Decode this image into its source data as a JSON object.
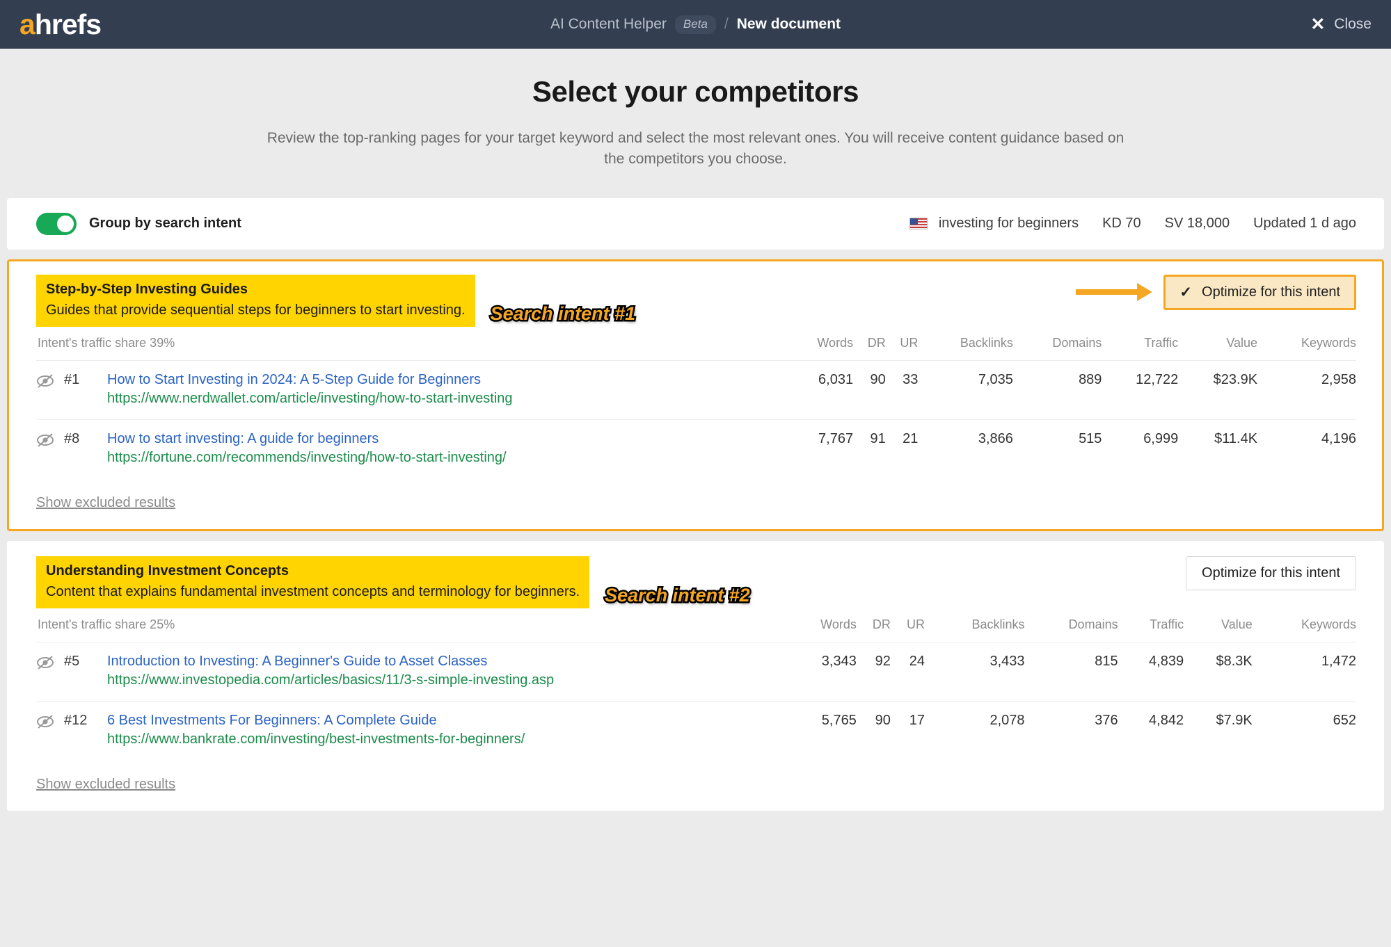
{
  "header": {
    "logo_a": "a",
    "logo_rest": "hrefs",
    "app_name": "AI Content Helper",
    "beta_label": "Beta",
    "separator": "/",
    "document_title": "New document",
    "close_label": "Close",
    "close_icon": "close-icon",
    "bg_color": "#333e51",
    "accent_color": "#f5a623"
  },
  "hero": {
    "title": "Select your competitors",
    "subtitle": "Review the top-ranking pages for your target keyword and select the most relevant ones. You will receive content guidance based on the competitors you choose."
  },
  "toolbar": {
    "toggle_label": "Group by search intent",
    "toggle_on": true,
    "toggle_color": "#18a957",
    "flag_icon": "us-flag-icon",
    "keyword": "investing for beginners",
    "kd": "KD 70",
    "sv": "SV 18,000",
    "updated": "Updated 1 d ago"
  },
  "table_headers": [
    "Words",
    "DR",
    "UR",
    "Backlinks",
    "Domains",
    "Traffic",
    "Value",
    "Keywords"
  ],
  "show_excluded_label": "Show excluded results",
  "optimize_label": "Optimize for this intent",
  "intents": [
    {
      "title": "Step-by-Step Investing Guides",
      "description": "Guides that provide sequential steps for beginners to start investing.",
      "annotation": "Search intent #1",
      "traffic_share": "Intent's traffic share 39%",
      "selected": true,
      "check_icon": "check-icon",
      "arrow_icon": "arrow-right-annotation",
      "results": [
        {
          "hide_icon": "eye-off-icon",
          "rank": "#1",
          "title": "How to Start Investing in 2024: A 5-Step Guide for Beginners",
          "url": "https://www.nerdwallet.com/article/investing/how-to-start-investing",
          "words": "6,031",
          "dr": "90",
          "ur": "33",
          "backlinks": "7,035",
          "domains": "889",
          "traffic": "12,722",
          "value": "$23.9K",
          "keywords": "2,958"
        },
        {
          "hide_icon": "eye-off-icon",
          "rank": "#8",
          "title": "How to start investing: A guide for beginners",
          "url": "https://fortune.com/recommends/investing/how-to-start-investing/",
          "words": "7,767",
          "dr": "91",
          "ur": "21",
          "backlinks": "3,866",
          "domains": "515",
          "traffic": "6,999",
          "value": "$11.4K",
          "keywords": "4,196"
        }
      ]
    },
    {
      "title": "Understanding Investment Concepts",
      "description": "Content that explains fundamental investment concepts and terminology for beginners.",
      "annotation": "Search intent #2",
      "traffic_share": "Intent's traffic share 25%",
      "selected": false,
      "results": [
        {
          "hide_icon": "eye-off-icon",
          "rank": "#5",
          "title": "Introduction to Investing: A Beginner's Guide to Asset Classes",
          "url": "https://www.investopedia.com/articles/basics/11/3-s-simple-investing.asp",
          "words": "3,343",
          "dr": "92",
          "ur": "24",
          "backlinks": "3,433",
          "domains": "815",
          "traffic": "4,839",
          "value": "$8.3K",
          "keywords": "1,472"
        },
        {
          "hide_icon": "eye-off-icon",
          "rank": "#12",
          "title": "6 Best Investments For Beginners: A Complete Guide",
          "url": "https://www.bankrate.com/investing/best-investments-for-beginners/",
          "words": "5,765",
          "dr": "90",
          "ur": "17",
          "backlinks": "2,078",
          "domains": "376",
          "traffic": "4,842",
          "value": "$7.9K",
          "keywords": "652"
        }
      ]
    }
  ]
}
